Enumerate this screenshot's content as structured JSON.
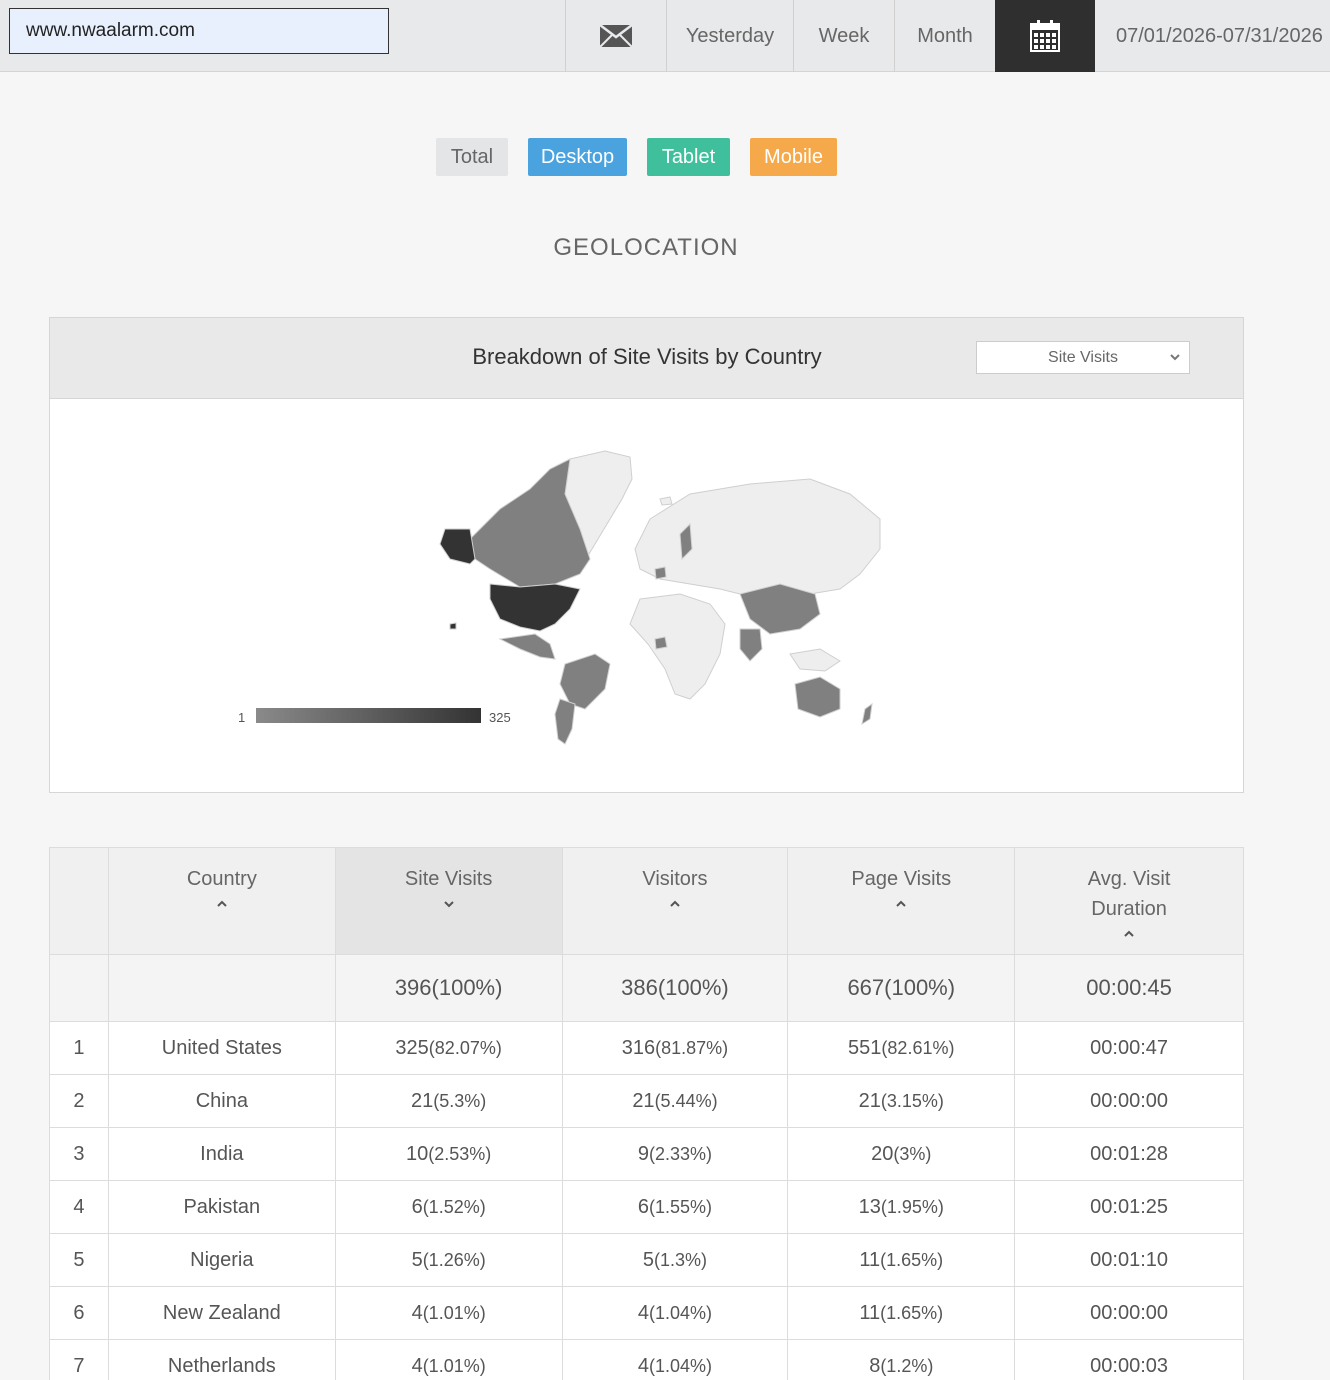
{
  "site": {
    "value": "www.nwaalarm.com"
  },
  "toolbar": {
    "mail_icon": "envelope-icon",
    "yesterday": "Yesterday",
    "week": "Week",
    "month": "Month",
    "calendar_icon": "calendar-icon",
    "date_range": "07/01/2026-07/31/2026"
  },
  "filters": {
    "total": "Total",
    "desktop": "Desktop",
    "tablet": "Tablet",
    "mobile": "Mobile"
  },
  "colors": {
    "desktop": "#4aa3df",
    "tablet": "#3fbf9b",
    "mobile": "#f5a94b",
    "active_toolbar": "#2f2f2f"
  },
  "section_title": "GEOLOCATION",
  "map_panel": {
    "title": "Breakdown of Site Visits by Country",
    "metric_selected": "Site Visits",
    "legend_min": "1",
    "legend_max": "325"
  },
  "table": {
    "headers": {
      "country": "Country",
      "site_visits": "Site Visits",
      "visitors": "Visitors",
      "page_visits": "Page Visits",
      "avg_duration_1": "Avg. Visit",
      "avg_duration_2": "Duration"
    },
    "totals": {
      "site_visits": "396(100%)",
      "visitors": "386(100%)",
      "page_visits": "667(100%)",
      "avg_duration": "00:00:45"
    },
    "rows": [
      {
        "rank": "1",
        "country": "United States",
        "sv": "325",
        "sv_pct": "(82.07%)",
        "vi": "316",
        "vi_pct": "(81.87%)",
        "pv": "551",
        "pv_pct": "(82.61%)",
        "dur": "00:00:47"
      },
      {
        "rank": "2",
        "country": "China",
        "sv": "21",
        "sv_pct": "(5.3%)",
        "vi": "21",
        "vi_pct": "(5.44%)",
        "pv": "21",
        "pv_pct": "(3.15%)",
        "dur": "00:00:00"
      },
      {
        "rank": "3",
        "country": "India",
        "sv": "10",
        "sv_pct": "(2.53%)",
        "vi": "9",
        "vi_pct": "(2.33%)",
        "pv": "20",
        "pv_pct": "(3%)",
        "dur": "00:01:28"
      },
      {
        "rank": "4",
        "country": "Pakistan",
        "sv": "6",
        "sv_pct": "(1.52%)",
        "vi": "6",
        "vi_pct": "(1.55%)",
        "pv": "13",
        "pv_pct": "(1.95%)",
        "dur": "00:01:25"
      },
      {
        "rank": "5",
        "country": "Nigeria",
        "sv": "5",
        "sv_pct": "(1.26%)",
        "vi": "5",
        "vi_pct": "(1.3%)",
        "pv": "11",
        "pv_pct": "(1.65%)",
        "dur": "00:01:10"
      },
      {
        "rank": "6",
        "country": "New Zealand",
        "sv": "4",
        "sv_pct": "(1.01%)",
        "vi": "4",
        "vi_pct": "(1.04%)",
        "pv": "11",
        "pv_pct": "(1.65%)",
        "dur": "00:00:00"
      },
      {
        "rank": "7",
        "country": "Netherlands",
        "sv": "4",
        "sv_pct": "(1.01%)",
        "vi": "4",
        "vi_pct": "(1.04%)",
        "pv": "8",
        "pv_pct": "(1.2%)",
        "dur": "00:00:03"
      }
    ]
  }
}
